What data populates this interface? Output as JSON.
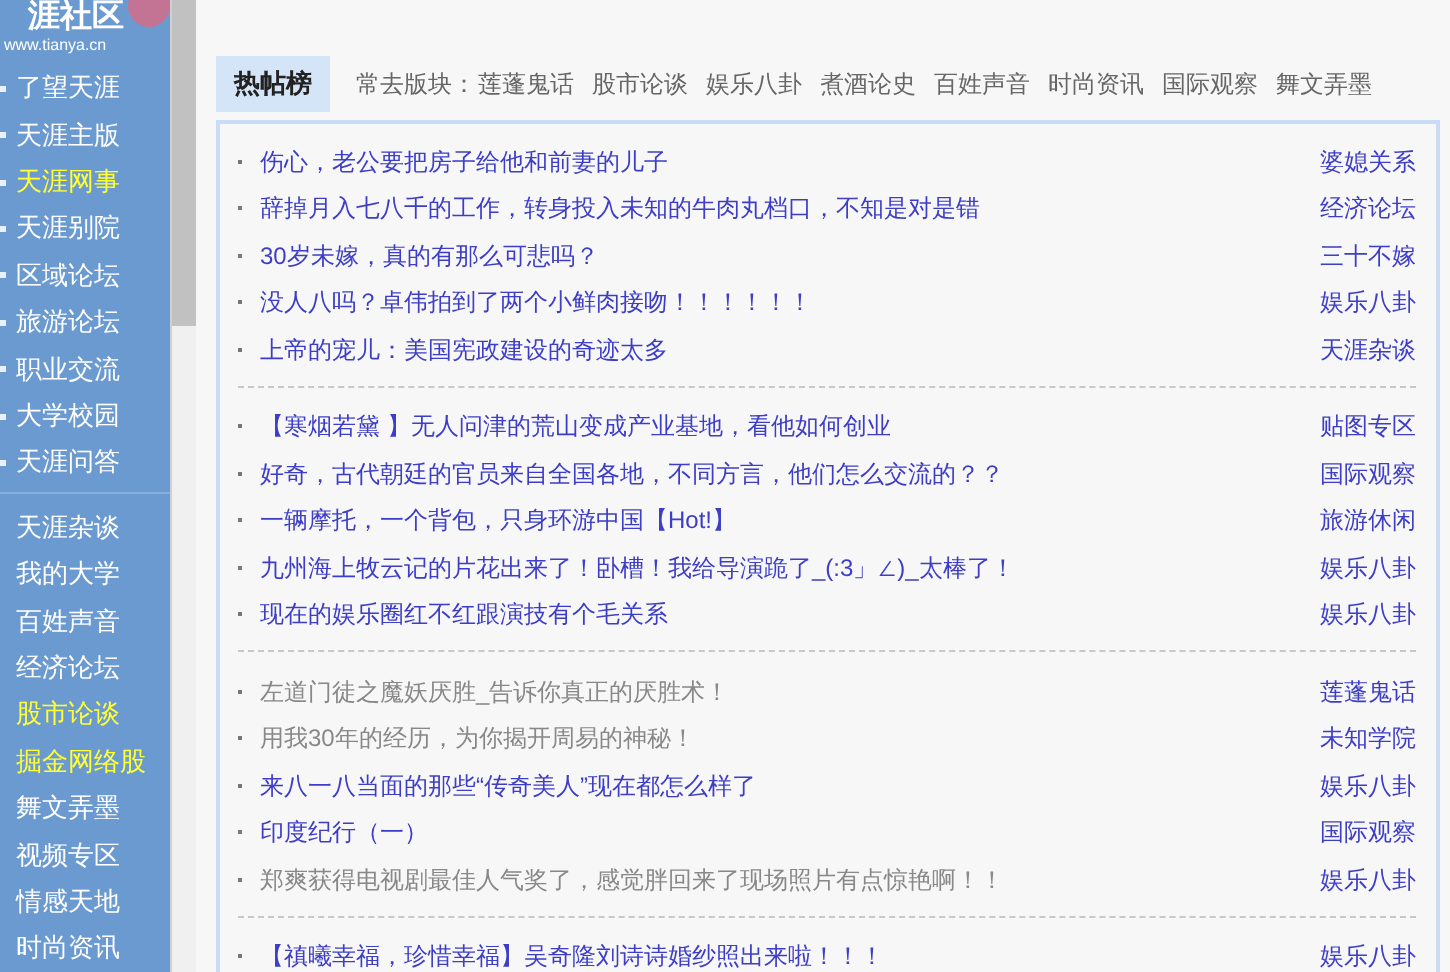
{
  "logo": {
    "title": "涯社区",
    "url": "www.tianya.cn"
  },
  "sidebar": {
    "groups": [
      {
        "bullets": true,
        "items": [
          {
            "label": "了望天涯",
            "highlighted": false
          },
          {
            "label": "天涯主版",
            "highlighted": false
          },
          {
            "label": "天涯网事",
            "highlighted": true
          },
          {
            "label": "天涯别院",
            "highlighted": false
          },
          {
            "label": "区域论坛",
            "highlighted": false
          },
          {
            "label": "旅游论坛",
            "highlighted": false
          },
          {
            "label": "职业交流",
            "highlighted": false
          },
          {
            "label": "大学校园",
            "highlighted": false
          },
          {
            "label": "天涯问答",
            "highlighted": false
          }
        ]
      },
      {
        "bullets": false,
        "items": [
          {
            "label": "天涯杂谈",
            "highlighted": false
          },
          {
            "label": "我的大学",
            "highlighted": false
          },
          {
            "label": "百姓声音",
            "highlighted": false
          },
          {
            "label": "经济论坛",
            "highlighted": false
          },
          {
            "label": "股市论谈",
            "highlighted": true
          },
          {
            "label": "掘金网络股",
            "highlighted": true
          },
          {
            "label": "舞文弄墨",
            "highlighted": false
          },
          {
            "label": "视频专区",
            "highlighted": false
          },
          {
            "label": "情感天地",
            "highlighted": false
          },
          {
            "label": "时尚资讯",
            "highlighted": false
          }
        ]
      }
    ]
  },
  "tab": {
    "label": "热帖榜",
    "selected": true
  },
  "frequent": {
    "label": "常去版块：",
    "boards": [
      "莲蓬鬼话",
      "股市论谈",
      "娱乐八卦",
      "煮酒论史",
      "百姓声音",
      "时尚资讯",
      "国际观察",
      "舞文弄墨"
    ]
  },
  "groups": [
    {
      "rows": [
        {
          "title": "伤心，老公要把房子给他和前妻的儿子",
          "board": "婆媳关系",
          "visited": false
        },
        {
          "title": "辞掉月入七八千的工作，转身投入未知的牛肉丸档口，不知是对是错",
          "board": "经济论坛",
          "visited": false
        },
        {
          "title": "30岁未嫁，真的有那么可悲吗？",
          "board": "三十不嫁",
          "visited": false
        },
        {
          "title": "没人八吗？卓伟拍到了两个小鲜肉接吻！！！！！！",
          "board": "娱乐八卦",
          "visited": false
        },
        {
          "title": "上帝的宠儿：美国宪政建设的奇迹太多",
          "board": "天涯杂谈",
          "visited": false
        }
      ]
    },
    {
      "rows": [
        {
          "title": "【寒烟若黛 】无人问津的荒山变成产业基地，看他如何创业",
          "board": "贴图专区",
          "visited": false
        },
        {
          "title": "好奇，古代朝廷的官员来自全国各地，不同方言，他们怎么交流的？？",
          "board": "国际观察",
          "visited": false
        },
        {
          "title": "一辆摩托，一个背包，只身环游中国【Hot!】",
          "board": "旅游休闲",
          "visited": false
        },
        {
          "title": "九州海上牧云记的片花出来了！卧槽！我给导演跪了_(:3」∠)_太棒了！",
          "board": "娱乐八卦",
          "visited": false
        },
        {
          "title": "现在的娱乐圈红不红跟演技有个毛关系",
          "board": "娱乐八卦",
          "visited": false
        }
      ]
    },
    {
      "rows": [
        {
          "title": "左道门徒之魔妖厌胜_告诉你真正的厌胜术！",
          "board": "莲蓬鬼话",
          "visited": true
        },
        {
          "title": "用我30年的经历，为你揭开周易的神秘！",
          "board": "未知学院",
          "visited": true
        },
        {
          "title": "来八一八当面的那些“传奇美人”现在都怎么样了",
          "board": "娱乐八卦",
          "visited": false
        },
        {
          "title": "印度纪行（一）",
          "board": "国际观察",
          "visited": false
        },
        {
          "title": "郑爽获得电视剧最佳人气奖了，感觉胖回来了现场照片有点惊艳啊！！",
          "board": "娱乐八卦",
          "visited": true
        }
      ]
    },
    {
      "rows": [
        {
          "title": "【禛曦幸福，珍惜幸福】吴奇隆刘诗诗婚纱照出来啦！！！",
          "board": "娱乐八卦",
          "visited": false
        }
      ]
    }
  ]
}
